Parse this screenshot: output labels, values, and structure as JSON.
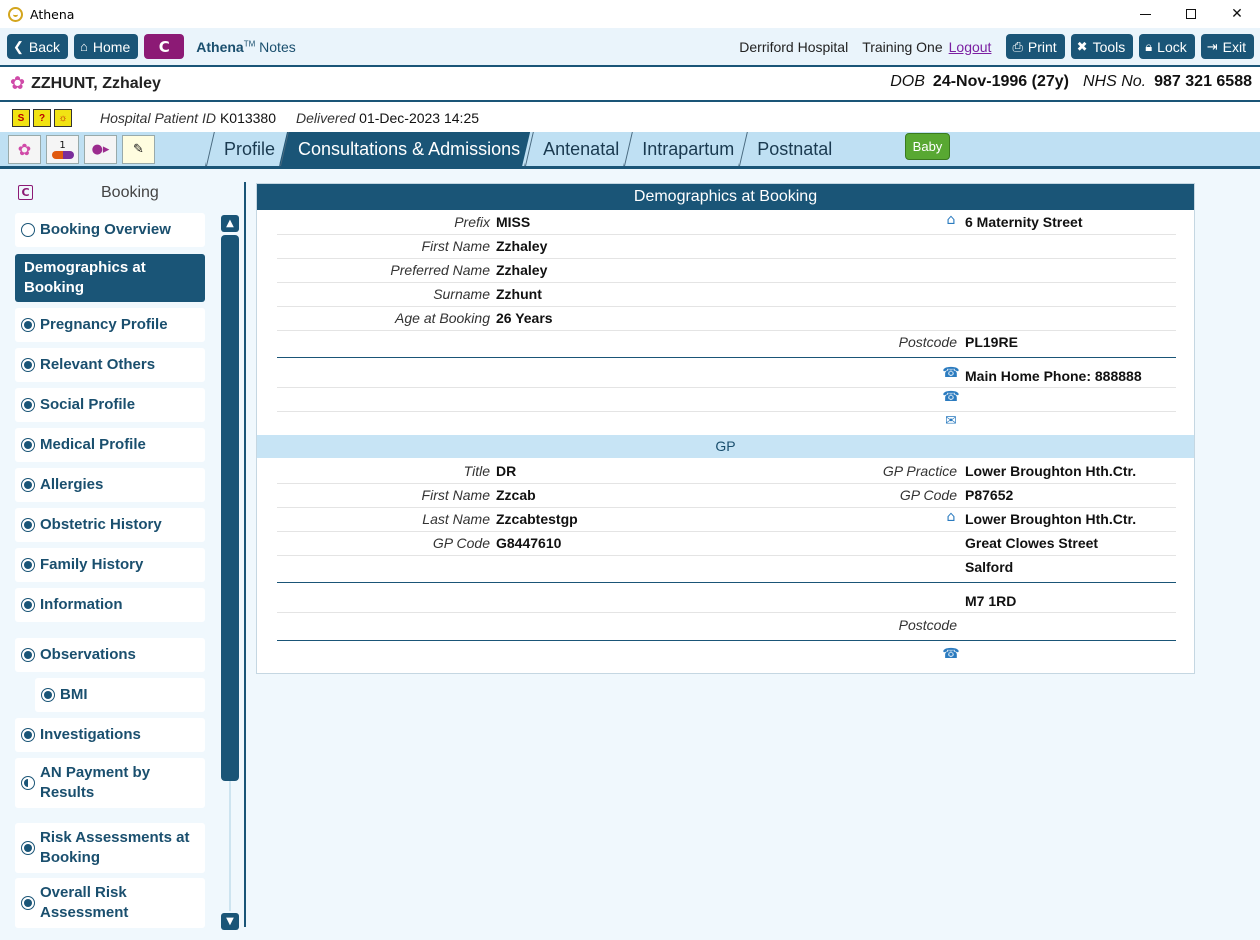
{
  "window": {
    "title": "Athena"
  },
  "toolbar": {
    "back": "Back",
    "home": "Home",
    "c_label": "C",
    "brand_bold": "Athena",
    "brand_tm": "TM",
    "brand_rest": " Notes",
    "hospital": "Derriford Hospital",
    "user": "Training One",
    "logout": "Logout",
    "print": "Print",
    "tools": "Tools",
    "lock": "Lock",
    "exit": "Exit"
  },
  "patient": {
    "name": "ZZHUNT, Zzhaley",
    "dob_label": "DOB",
    "dob": "24-Nov-1996 (27y)",
    "nhs_label": "NHS No.",
    "nhs": "987 321 6588"
  },
  "info": {
    "hospital_id_label": "Hospital Patient ID",
    "hospital_id": "K013380",
    "delivered_label": "Delivered",
    "delivered": "01-Dec-2023 14:25",
    "mini_icons": [
      "S",
      "?",
      "☼"
    ]
  },
  "nav": {
    "tabs": [
      "Profile",
      "Consultations & Admissions",
      "Antenatal",
      "Intrapartum",
      "Postnatal"
    ],
    "active_tab": "Consultations & Admissions",
    "baby": "Baby",
    "navicon_number": "1"
  },
  "sidebar": {
    "title": "Booking",
    "items": [
      "Booking Overview",
      "Demographics at Booking",
      "Pregnancy Profile",
      "Relevant Others",
      "Social Profile",
      "Medical Profile",
      "Allergies",
      "Obstetric History",
      "Family History",
      "Information",
      "Observations",
      "BMI",
      "Investigations",
      "AN Payment by Results",
      "Risk Assessments at Booking",
      "Overall Risk Assessment"
    ]
  },
  "panel": {
    "title": "Demographics at Booking",
    "demo": {
      "prefix_label": "Prefix",
      "prefix": "MISS",
      "first_label": "First Name",
      "first": "Zzhaley",
      "preferred_label": "Preferred Name",
      "preferred": "Zzhaley",
      "surname_label": "Surname",
      "surname": "Zzhunt",
      "age_label": "Age at Booking",
      "age": "26 Years",
      "address": "6 Maternity Street",
      "postcode_label": "Postcode",
      "postcode": "PL19RE",
      "phone": "Main Home Phone: 888888"
    },
    "gp": {
      "section_title": "GP",
      "title_label": "Title",
      "title": "DR",
      "first_label": "First Name",
      "first": "Zzcab",
      "last_label": "Last Name",
      "last": "Zzcabtestgp",
      "code_label": "GP Code",
      "code": "G8447610",
      "practice_label": "GP Practice",
      "practice": "Lower Broughton Hth.Ctr.",
      "practice_code_label": "GP Code",
      "practice_code": "P87652",
      "address1": "Lower Broughton Hth.Ctr.",
      "address2": "Great Clowes Street",
      "address3": "Salford",
      "address4": "M7 1RD",
      "postcode_label": "Postcode"
    }
  },
  "colors": {
    "primary": "#1a5577",
    "accent": "#8c1a75",
    "tab_bg": "#bfe0f3",
    "baby": "#58a832"
  }
}
